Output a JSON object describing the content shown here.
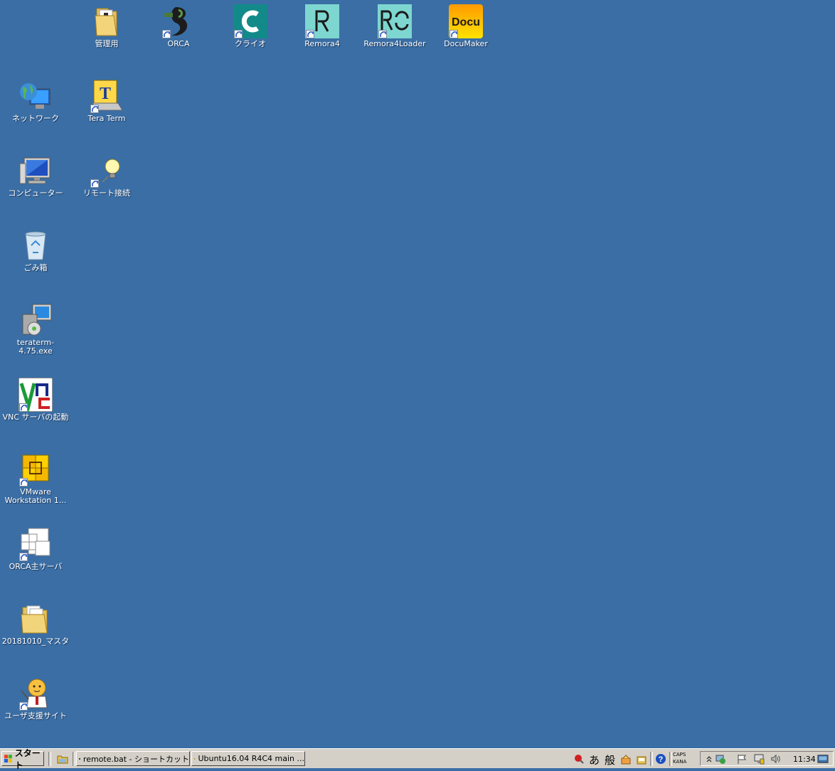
{
  "desktop": {
    "icons": [
      {
        "label": "管理用",
        "icon": "folder-document-icon"
      },
      {
        "label": "ORCA",
        "icon": "orca-app-icon"
      },
      {
        "label": "クライオ",
        "icon": "claio-app-icon"
      },
      {
        "label": "Remora4",
        "icon": "remora4-app-icon"
      },
      {
        "label": "Remora4Loader",
        "icon": "remora4loader-app-icon"
      },
      {
        "label": "DocuMaker",
        "icon": "documaker-app-icon",
        "logo_text": "Docu"
      },
      {
        "label": "ネットワーク",
        "icon": "network-globe-icon"
      },
      {
        "label": "Tera Term",
        "icon": "teraterm-app-icon",
        "logo_text": "T"
      },
      {
        "label": "コンピューター",
        "icon": "computer-monitor-icon"
      },
      {
        "label": "リモート接続",
        "icon": "remote-connect-bulb-icon"
      },
      {
        "label": "ごみ箱",
        "icon": "recycle-bin-icon"
      },
      {
        "label": "teraterm-4.75.exe",
        "icon": "installer-icon"
      },
      {
        "label": "VNC サーバの起動",
        "icon": "vnc-app-icon"
      },
      {
        "label": "VMware Workstation 1...",
        "icon": "vmware-app-icon"
      },
      {
        "label": "ORCA主サーバ",
        "icon": "windows-grid-icon"
      },
      {
        "label": "20181010_マスタ",
        "icon": "folder-icon"
      },
      {
        "label": "ユーザ支援サイト",
        "icon": "support-mascot-icon"
      }
    ]
  },
  "taskbar": {
    "start_label": "スタート",
    "tasks": [
      {
        "label": "remote.bat - ショートカット",
        "icon": "cmd-icon"
      },
      {
        "label": "Ubuntu16.04 R4C4 main ...",
        "icon": "vm-icon"
      }
    ],
    "ime": {
      "mode": "あ",
      "type": "般"
    },
    "caps": "CAPS",
    "kana": "KANA",
    "clock": "11:34"
  },
  "colors": {
    "desktop_bg": "#3a6ea5",
    "taskbar_bg": "#d4d0c8"
  }
}
